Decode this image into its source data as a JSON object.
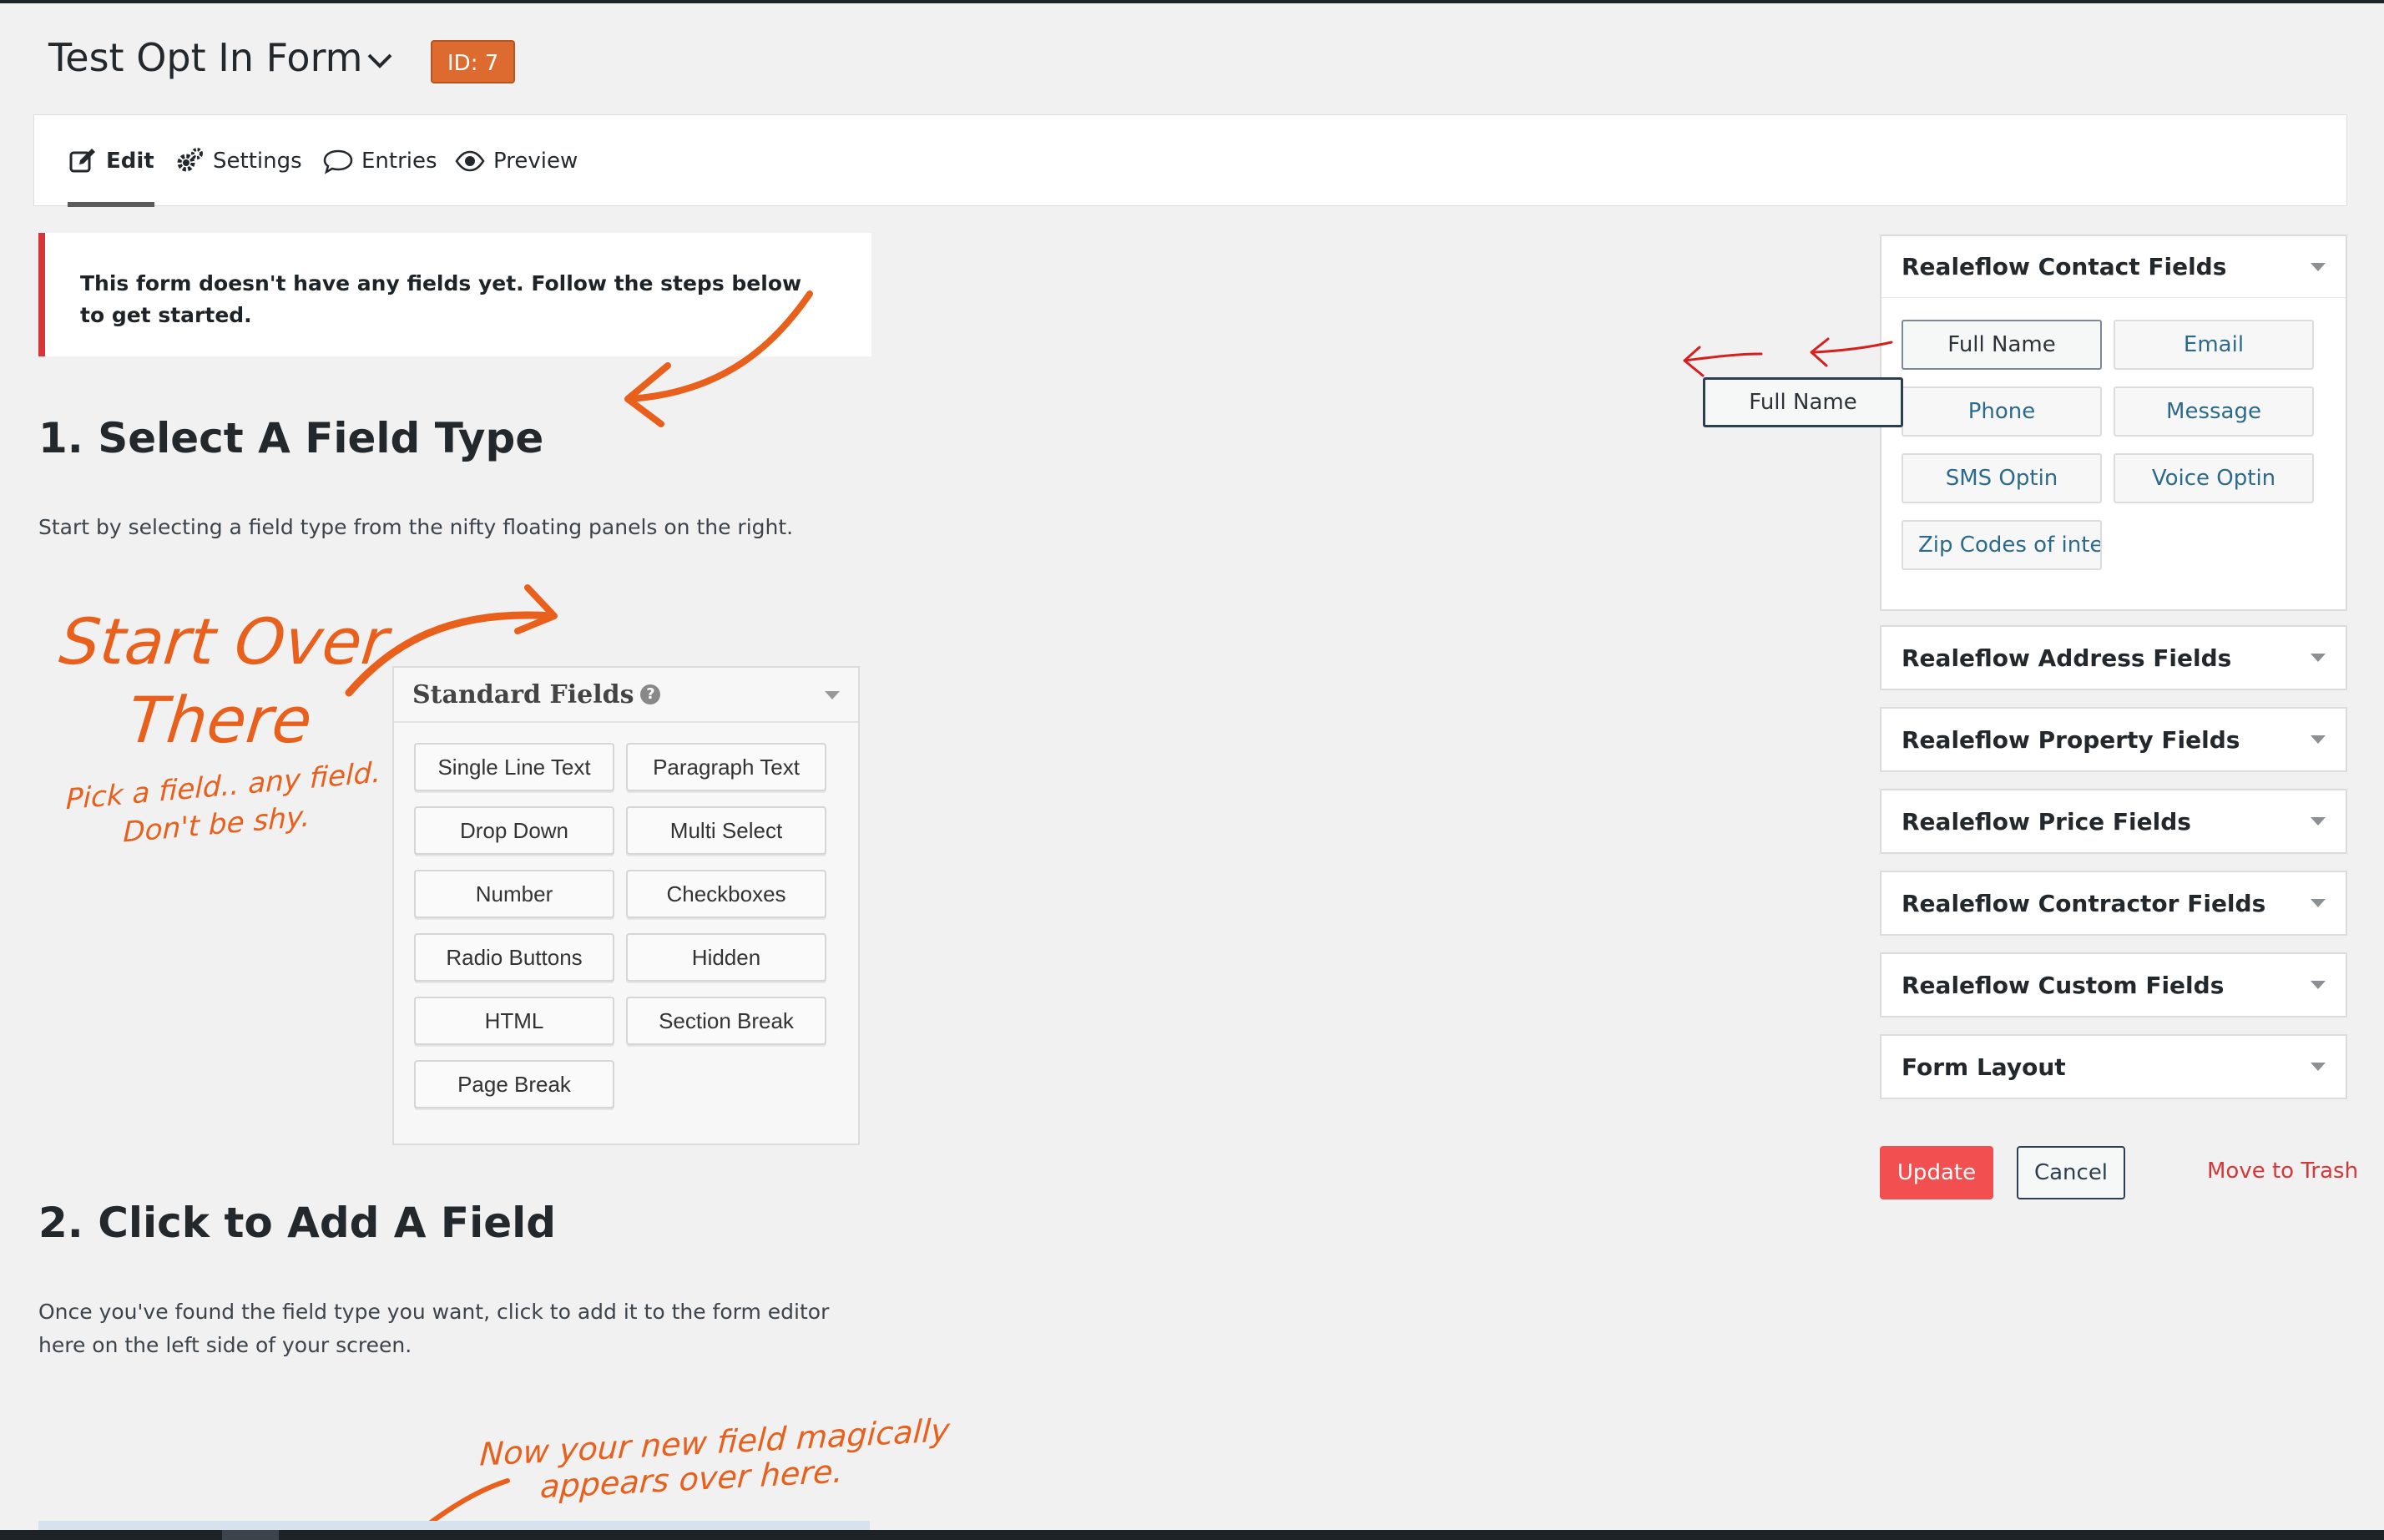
{
  "header": {
    "form_title": "Test Opt In Form",
    "id_badge": "ID: 7"
  },
  "tabs": [
    {
      "label": "Edit",
      "icon": "edit-icon",
      "active": true
    },
    {
      "label": "Settings",
      "icon": "gears-icon",
      "active": false
    },
    {
      "label": "Entries",
      "icon": "comment-icon",
      "active": false
    },
    {
      "label": "Preview",
      "icon": "eye-icon",
      "active": false
    }
  ],
  "notice": {
    "text": "This form doesn't have any fields yet. Follow the steps below to get started."
  },
  "steps": [
    {
      "title": "1. Select A Field Type",
      "description": "Start by selecting a field type from the nifty floating panels on the right."
    },
    {
      "title": "2. Click to Add A Field",
      "description": "Once you've found the field type you want, click to add it to the form editor here on the left side of your screen."
    }
  ],
  "illustration": {
    "handwriting_1_line1": "Start Over",
    "handwriting_1_line2": "There",
    "handwriting_2_line1": "Pick a field.. any field.",
    "handwriting_2_line2": "Don't be shy.",
    "handwriting_3_line1": "Now your new field magically",
    "handwriting_3_line2": "appears over here.",
    "panel_title": "Standard Fields",
    "panel_buttons": [
      "Single Line Text",
      "Paragraph Text",
      "Drop Down",
      "Multi Select",
      "Number",
      "Checkboxes",
      "Radio Buttons",
      "Hidden",
      "HTML",
      "Section Break",
      "Page Break"
    ]
  },
  "sidebar": {
    "contact": {
      "title": "Realeflow Contact Fields",
      "buttons": [
        "Full Name",
        "Email",
        "Phone",
        "Message",
        "SMS Optin",
        "Voice Optin",
        "Zip Codes of intere"
      ]
    },
    "collapsed": [
      "Realeflow Address Fields",
      "Realeflow Property Fields",
      "Realeflow Price Fields",
      "Realeflow Contractor Fields",
      "Realeflow Custom Fields",
      "Form Layout"
    ],
    "drag_ghost": "Full Name"
  },
  "actions": {
    "update": "Update",
    "cancel": "Cancel",
    "trash": "Move to Trash"
  },
  "colors": {
    "accent_orange": "#dd6a2f",
    "notice_red": "#d63638",
    "update_red": "#f25050",
    "link_blue": "#2c6a8c"
  }
}
